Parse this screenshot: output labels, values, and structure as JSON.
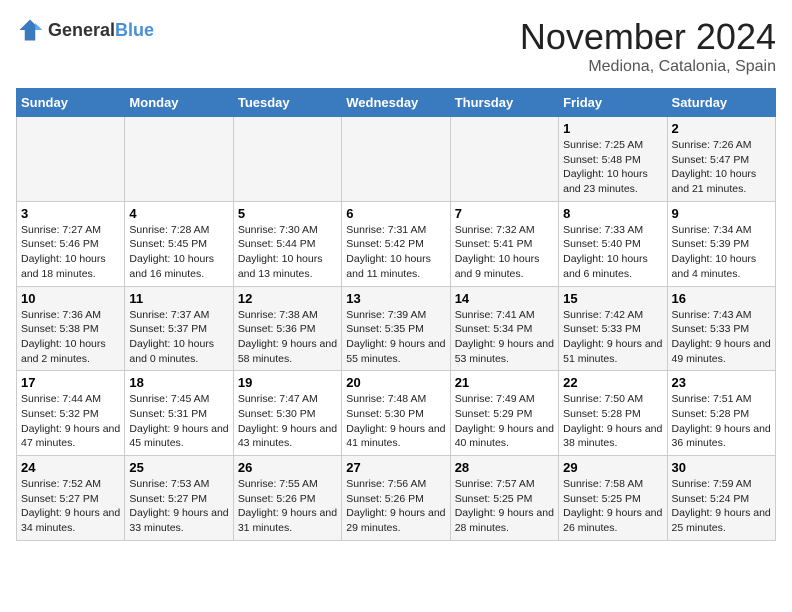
{
  "header": {
    "logo_general": "General",
    "logo_blue": "Blue",
    "month": "November 2024",
    "location": "Mediona, Catalonia, Spain"
  },
  "weekdays": [
    "Sunday",
    "Monday",
    "Tuesday",
    "Wednesday",
    "Thursday",
    "Friday",
    "Saturday"
  ],
  "weeks": [
    [
      {
        "day": "",
        "sunrise": "",
        "sunset": "",
        "daylight": ""
      },
      {
        "day": "",
        "sunrise": "",
        "sunset": "",
        "daylight": ""
      },
      {
        "day": "",
        "sunrise": "",
        "sunset": "",
        "daylight": ""
      },
      {
        "day": "",
        "sunrise": "",
        "sunset": "",
        "daylight": ""
      },
      {
        "day": "",
        "sunrise": "",
        "sunset": "",
        "daylight": ""
      },
      {
        "day": "1",
        "sunrise": "Sunrise: 7:25 AM",
        "sunset": "Sunset: 5:48 PM",
        "daylight": "Daylight: 10 hours and 23 minutes."
      },
      {
        "day": "2",
        "sunrise": "Sunrise: 7:26 AM",
        "sunset": "Sunset: 5:47 PM",
        "daylight": "Daylight: 10 hours and 21 minutes."
      }
    ],
    [
      {
        "day": "3",
        "sunrise": "Sunrise: 7:27 AM",
        "sunset": "Sunset: 5:46 PM",
        "daylight": "Daylight: 10 hours and 18 minutes."
      },
      {
        "day": "4",
        "sunrise": "Sunrise: 7:28 AM",
        "sunset": "Sunset: 5:45 PM",
        "daylight": "Daylight: 10 hours and 16 minutes."
      },
      {
        "day": "5",
        "sunrise": "Sunrise: 7:30 AM",
        "sunset": "Sunset: 5:44 PM",
        "daylight": "Daylight: 10 hours and 13 minutes."
      },
      {
        "day": "6",
        "sunrise": "Sunrise: 7:31 AM",
        "sunset": "Sunset: 5:42 PM",
        "daylight": "Daylight: 10 hours and 11 minutes."
      },
      {
        "day": "7",
        "sunrise": "Sunrise: 7:32 AM",
        "sunset": "Sunset: 5:41 PM",
        "daylight": "Daylight: 10 hours and 9 minutes."
      },
      {
        "day": "8",
        "sunrise": "Sunrise: 7:33 AM",
        "sunset": "Sunset: 5:40 PM",
        "daylight": "Daylight: 10 hours and 6 minutes."
      },
      {
        "day": "9",
        "sunrise": "Sunrise: 7:34 AM",
        "sunset": "Sunset: 5:39 PM",
        "daylight": "Daylight: 10 hours and 4 minutes."
      }
    ],
    [
      {
        "day": "10",
        "sunrise": "Sunrise: 7:36 AM",
        "sunset": "Sunset: 5:38 PM",
        "daylight": "Daylight: 10 hours and 2 minutes."
      },
      {
        "day": "11",
        "sunrise": "Sunrise: 7:37 AM",
        "sunset": "Sunset: 5:37 PM",
        "daylight": "Daylight: 10 hours and 0 minutes."
      },
      {
        "day": "12",
        "sunrise": "Sunrise: 7:38 AM",
        "sunset": "Sunset: 5:36 PM",
        "daylight": "Daylight: 9 hours and 58 minutes."
      },
      {
        "day": "13",
        "sunrise": "Sunrise: 7:39 AM",
        "sunset": "Sunset: 5:35 PM",
        "daylight": "Daylight: 9 hours and 55 minutes."
      },
      {
        "day": "14",
        "sunrise": "Sunrise: 7:41 AM",
        "sunset": "Sunset: 5:34 PM",
        "daylight": "Daylight: 9 hours and 53 minutes."
      },
      {
        "day": "15",
        "sunrise": "Sunrise: 7:42 AM",
        "sunset": "Sunset: 5:33 PM",
        "daylight": "Daylight: 9 hours and 51 minutes."
      },
      {
        "day": "16",
        "sunrise": "Sunrise: 7:43 AM",
        "sunset": "Sunset: 5:33 PM",
        "daylight": "Daylight: 9 hours and 49 minutes."
      }
    ],
    [
      {
        "day": "17",
        "sunrise": "Sunrise: 7:44 AM",
        "sunset": "Sunset: 5:32 PM",
        "daylight": "Daylight: 9 hours and 47 minutes."
      },
      {
        "day": "18",
        "sunrise": "Sunrise: 7:45 AM",
        "sunset": "Sunset: 5:31 PM",
        "daylight": "Daylight: 9 hours and 45 minutes."
      },
      {
        "day": "19",
        "sunrise": "Sunrise: 7:47 AM",
        "sunset": "Sunset: 5:30 PM",
        "daylight": "Daylight: 9 hours and 43 minutes."
      },
      {
        "day": "20",
        "sunrise": "Sunrise: 7:48 AM",
        "sunset": "Sunset: 5:30 PM",
        "daylight": "Daylight: 9 hours and 41 minutes."
      },
      {
        "day": "21",
        "sunrise": "Sunrise: 7:49 AM",
        "sunset": "Sunset: 5:29 PM",
        "daylight": "Daylight: 9 hours and 40 minutes."
      },
      {
        "day": "22",
        "sunrise": "Sunrise: 7:50 AM",
        "sunset": "Sunset: 5:28 PM",
        "daylight": "Daylight: 9 hours and 38 minutes."
      },
      {
        "day": "23",
        "sunrise": "Sunrise: 7:51 AM",
        "sunset": "Sunset: 5:28 PM",
        "daylight": "Daylight: 9 hours and 36 minutes."
      }
    ],
    [
      {
        "day": "24",
        "sunrise": "Sunrise: 7:52 AM",
        "sunset": "Sunset: 5:27 PM",
        "daylight": "Daylight: 9 hours and 34 minutes."
      },
      {
        "day": "25",
        "sunrise": "Sunrise: 7:53 AM",
        "sunset": "Sunset: 5:27 PM",
        "daylight": "Daylight: 9 hours and 33 minutes."
      },
      {
        "day": "26",
        "sunrise": "Sunrise: 7:55 AM",
        "sunset": "Sunset: 5:26 PM",
        "daylight": "Daylight: 9 hours and 31 minutes."
      },
      {
        "day": "27",
        "sunrise": "Sunrise: 7:56 AM",
        "sunset": "Sunset: 5:26 PM",
        "daylight": "Daylight: 9 hours and 29 minutes."
      },
      {
        "day": "28",
        "sunrise": "Sunrise: 7:57 AM",
        "sunset": "Sunset: 5:25 PM",
        "daylight": "Daylight: 9 hours and 28 minutes."
      },
      {
        "day": "29",
        "sunrise": "Sunrise: 7:58 AM",
        "sunset": "Sunset: 5:25 PM",
        "daylight": "Daylight: 9 hours and 26 minutes."
      },
      {
        "day": "30",
        "sunrise": "Sunrise: 7:59 AM",
        "sunset": "Sunset: 5:24 PM",
        "daylight": "Daylight: 9 hours and 25 minutes."
      }
    ]
  ]
}
